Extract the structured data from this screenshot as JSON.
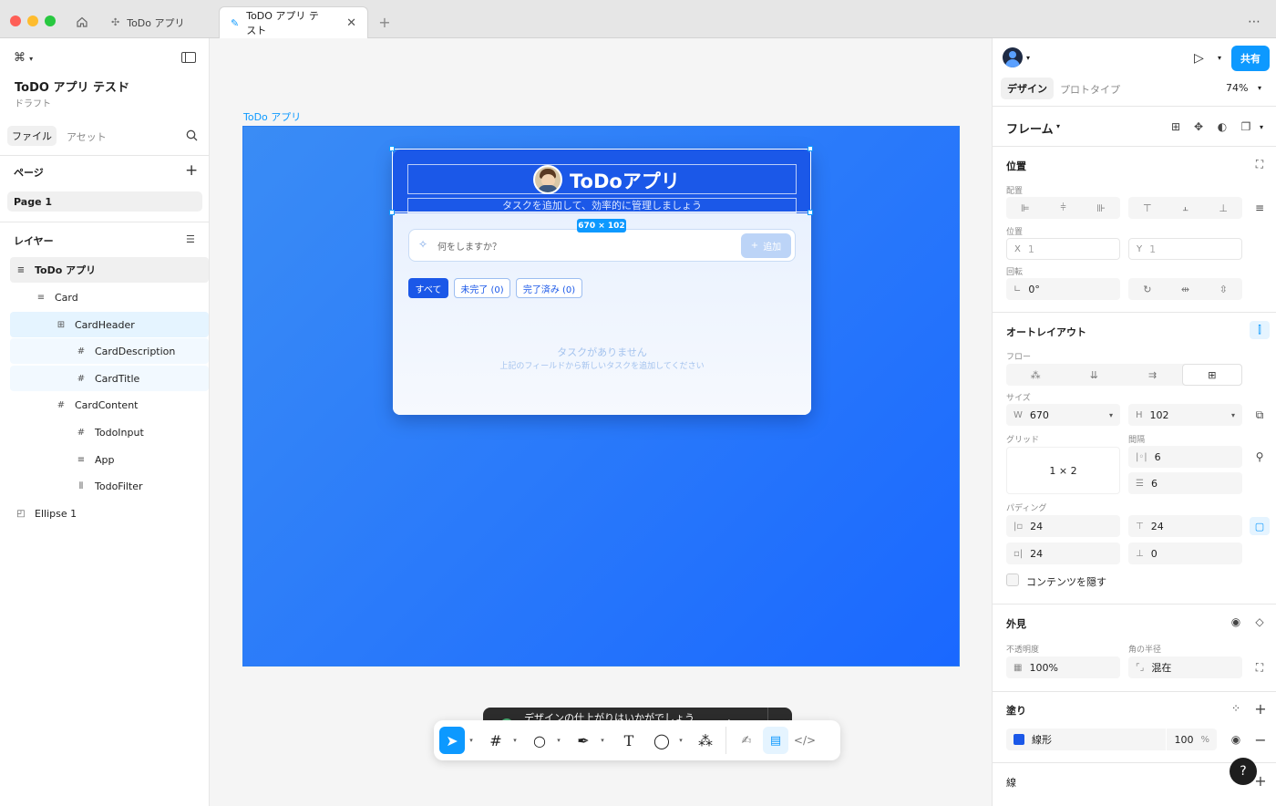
{
  "tabs": {
    "tab1": "ToDo アプリ",
    "tab2": "ToDO アプリ テスト"
  },
  "left": {
    "file_name": "ToDO アプリ テスト",
    "file_status": "ドラフト",
    "tab_file": "ファイル",
    "tab_assets": "アセット",
    "pages_title": "ページ",
    "page1": "Page 1",
    "layers_title": "レイヤー",
    "layers": [
      {
        "name": "ToDo アプリ"
      },
      {
        "name": "Card"
      },
      {
        "name": "CardHeader"
      },
      {
        "name": "CardDescription"
      },
      {
        "name": "CardTitle"
      },
      {
        "name": "CardContent"
      },
      {
        "name": "TodoInput"
      },
      {
        "name": "App"
      },
      {
        "name": "TodoFilter"
      },
      {
        "name": "Ellipse 1"
      }
    ]
  },
  "canvas": {
    "frame_label": "ToDo アプリ",
    "size_badge": "670 × 102",
    "app_title": "ToDoアプリ",
    "app_subtitle": "タスクを追加して、効率的に管理しましょう",
    "input_placeholder": "何をしますか？",
    "add_button": "追加",
    "filter_all": "すべて",
    "filter_active": "未完了 (0)",
    "filter_done": "完了済み (0)",
    "empty_title": "タスクがありません",
    "empty_desc": "上記のフィールドから新しいタスクを追加してください"
  },
  "toast": {
    "text": "デザインの仕上がりはいかがでしょうか?"
  },
  "right": {
    "share": "共有",
    "tab_design": "デザイン",
    "tab_prototype": "プロトタイプ",
    "zoom": "74%",
    "frame_type": "フレーム",
    "position_title": "位置",
    "align_label": "配置",
    "pos_label": "位置",
    "x_prefix": "X",
    "x_value": "1",
    "y_prefix": "Y",
    "y_value": "1",
    "rotation_label": "回転",
    "rotation_value": "0°",
    "autolayout_title": "オートレイアウト",
    "flow_label": "フロー",
    "size_label": "サイズ",
    "w_prefix": "W",
    "w_value": "670",
    "h_prefix": "H",
    "h_value": "102",
    "grid_label": "グリッド",
    "gap_label": "間隔",
    "grid_value": "1 × 2",
    "gap_h": "6",
    "gap_v": "6",
    "padding_label": "パディング",
    "pad_left": "24",
    "pad_top": "24",
    "pad_right": "24",
    "pad_bottom": "0",
    "clip_label": "コンテンツを隠す",
    "appearance_title": "外見",
    "opacity_label": "不透明度",
    "radius_label": "角の半径",
    "opacity_value": "100%",
    "radius_value": "混在",
    "fill_title": "塗り",
    "fill_type": "線形",
    "fill_opacity": "100",
    "fill_pct": "%",
    "stroke_title": "線",
    "help": "?"
  },
  "colors": {
    "accent": "#0d99ff",
    "canvas_blue": "#1a68ff",
    "header_blue": "#1b58e8"
  }
}
